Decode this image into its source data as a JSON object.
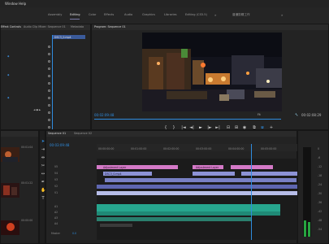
{
  "menu": {
    "window": "Window",
    "help": "Help"
  },
  "workspaces": {
    "items": [
      "Assembly",
      "Editing",
      "Color",
      "Effects",
      "Audio",
      "Graphics",
      "Libraries",
      "Editing (CS5.5)"
    ],
    "active": "Editing",
    "right_label": "普通剪辑工作",
    "overflow": "»"
  },
  "effect_controls": {
    "tab_label": "Effect Controls",
    "tab2_label": "Audio Clip Mixer: Sequence 01",
    "tab3_label": "Metadata",
    "clip_name": "DSC3_0.mp4"
  },
  "program_monitor": {
    "tab_label": "Program: Sequence 01",
    "timecode": "00:02:09:48",
    "fit": "Fit",
    "quality": "Full",
    "duration": "00:02:08:29"
  },
  "project": {
    "timecodes": [
      "00:01:04",
      "00:01:22",
      "00:00:00"
    ]
  },
  "timeline": {
    "tab_label": "Sequence 01",
    "tab2_label": "Sequence 02",
    "timecode": "00:03:09:48",
    "ruler": [
      "00:00:00:00",
      "00:01:00:00",
      "00:02:00:00",
      "00:03:00:00",
      "00:04:00:00",
      "00:05:00:00",
      "00:06:00:00"
    ],
    "tracks": [
      "V5",
      "V4",
      "V3",
      "V2",
      "V1",
      "A1",
      "A2",
      "A3",
      "A4"
    ],
    "master_label": "Master",
    "master_value": "0.0",
    "clip_label": "Adjustment Layer",
    "clip_label2": "DSC3_0.mp4"
  },
  "meter_labels": [
    "0",
    "-6",
    "-12",
    "-18",
    "-24",
    "-30",
    "-36",
    "-42",
    "-48",
    "-54"
  ],
  "colors": {
    "accent_blue": "#2f8cde",
    "clip_pink": "#d479c7",
    "clip_teal": "#27a68e",
    "clip_video": "#8d93d6"
  }
}
